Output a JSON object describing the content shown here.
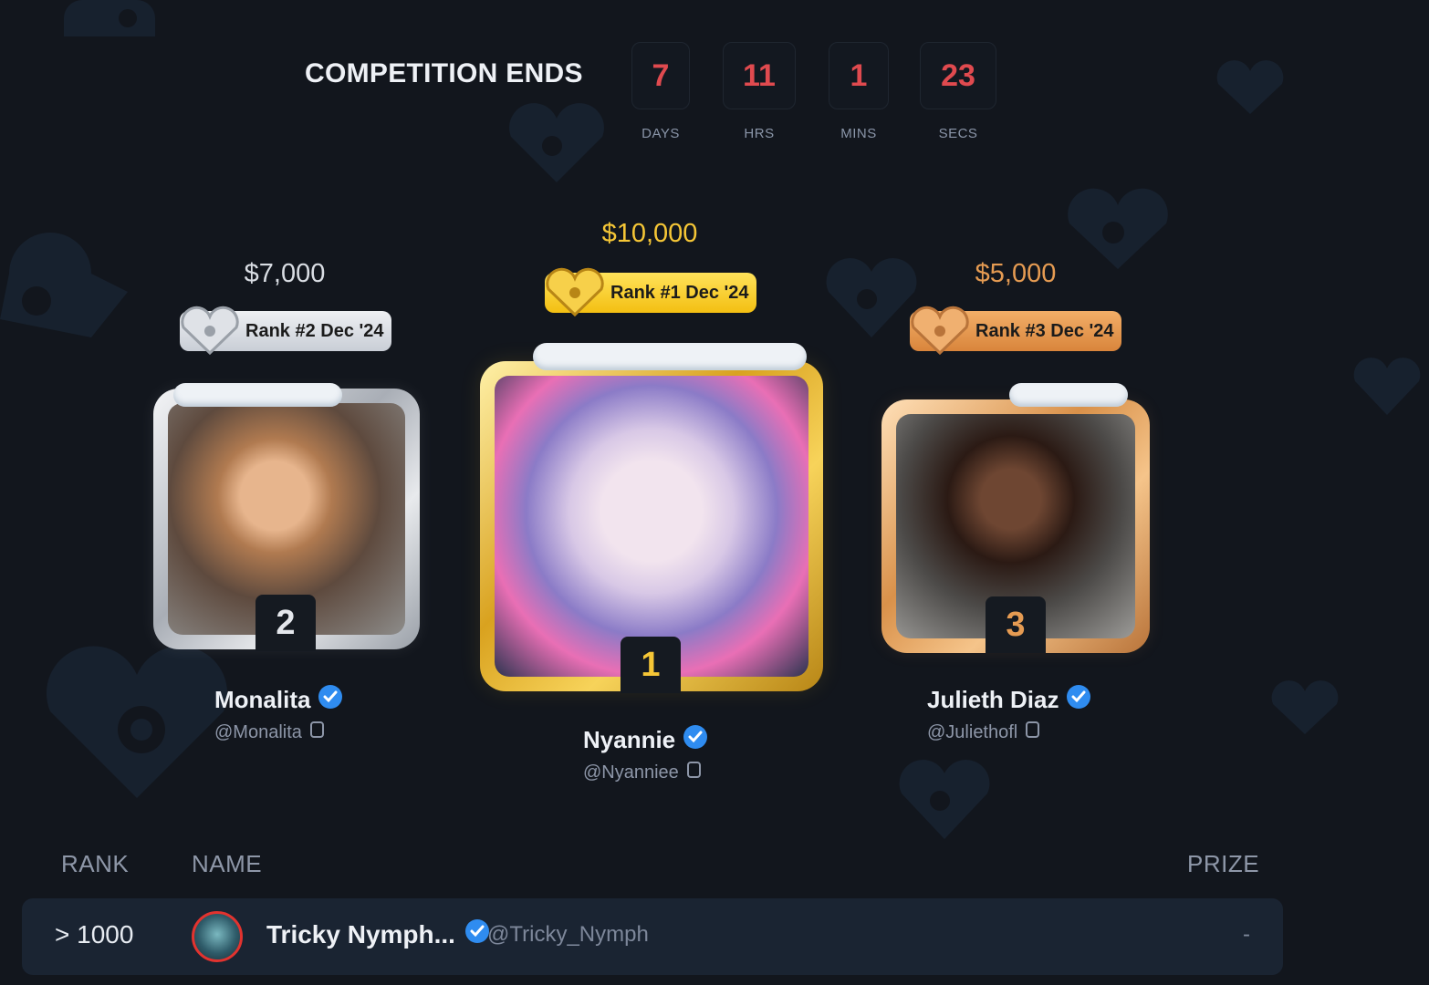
{
  "countdown": {
    "title": "COMPETITION ENDS",
    "units": [
      {
        "value": "7",
        "label": "DAYS"
      },
      {
        "value": "11",
        "label": "HRS"
      },
      {
        "value": "1",
        "label": "MINS"
      },
      {
        "value": "23",
        "label": "SECS"
      }
    ]
  },
  "podium": {
    "first": {
      "prize": "$10,000",
      "badge": "Rank #1 Dec '24",
      "rank": "1",
      "name": "Nyannie",
      "handle": "@Nyanniee"
    },
    "second": {
      "prize": "$7,000",
      "badge": "Rank #2 Dec '24",
      "rank": "2",
      "name": "Monalita",
      "handle": "@Monalita"
    },
    "third": {
      "prize": "$5,000",
      "badge": "Rank #3 Dec '24",
      "rank": "3",
      "name": "Julieth Diaz",
      "handle": "@Juliethofl"
    }
  },
  "table": {
    "headers": {
      "rank": "RANK",
      "name": "NAME",
      "prize": "PRIZE"
    },
    "rows": [
      {
        "rank": "> 1000",
        "name": "Tricky Nymph...",
        "handle": "@Tricky_Nymph",
        "prize": "-"
      }
    ]
  },
  "colors": {
    "background": "#12161d",
    "timer_digits": "#e04a4f",
    "gold": "#f5c636",
    "silver": "#d9dde3",
    "bronze": "#e59b52",
    "verified": "#2f8cf0"
  },
  "icons": [
    "lock-heart-icon",
    "verified-badge-icon",
    "copy-icon"
  ]
}
